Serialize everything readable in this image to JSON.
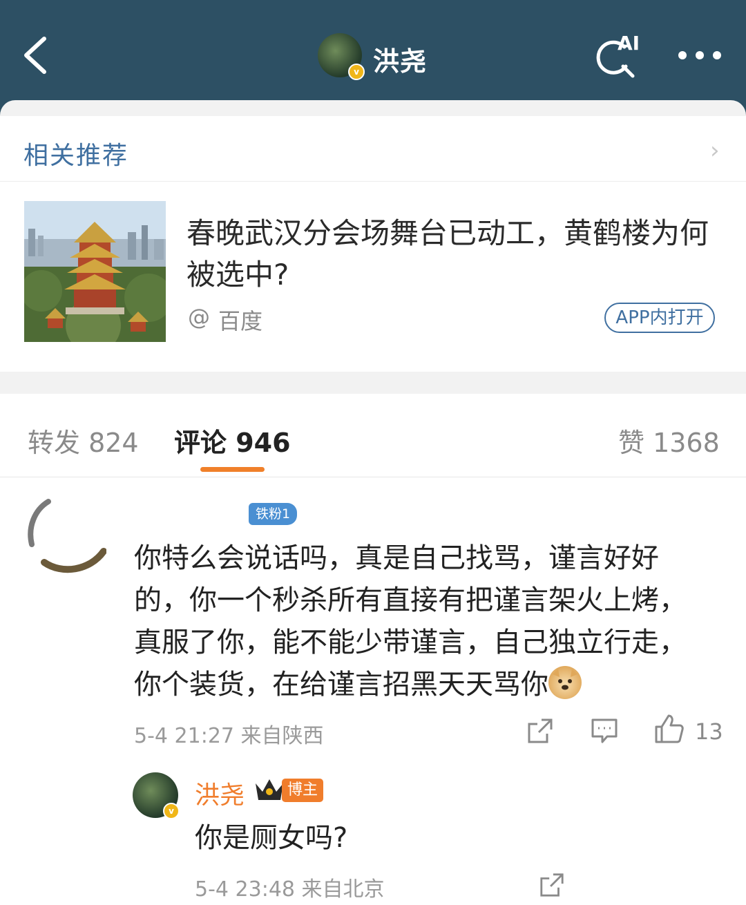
{
  "header": {
    "title": "洪尧",
    "ai_label": "AI"
  },
  "recommend": {
    "title": "相关推荐",
    "article_title": "春晚武汉分会场舞台已动工，黄鹤楼为何被选中?",
    "source_at": "@",
    "source_name": "百度",
    "open_button": "APP内打开"
  },
  "tabs": [
    {
      "label": "转发 824"
    },
    {
      "label": "评论 946"
    },
    {
      "label": "赞 1368"
    }
  ],
  "comment": {
    "fan_badge": "铁粉1",
    "text": "你特么会说话吗，真是自己找骂，谨言好好的，你一个秒杀所有直接有把谨言架火上烤，真服了你，能不能少带谨言，自己独立行走，你个装货，在给谨言招黑天天骂你",
    "meta": "5-4 21:27 来自陕西",
    "likes": "13"
  },
  "reply": {
    "name": "洪尧",
    "badge": "博主",
    "text": "你是厕女吗?",
    "meta": "5-4 23:48 来自北京"
  },
  "colors": {
    "header_bg": "#2d5064",
    "link_blue": "#3f6fa0",
    "accent_orange": "#f07d2c",
    "verified_gold": "#f0b618"
  }
}
